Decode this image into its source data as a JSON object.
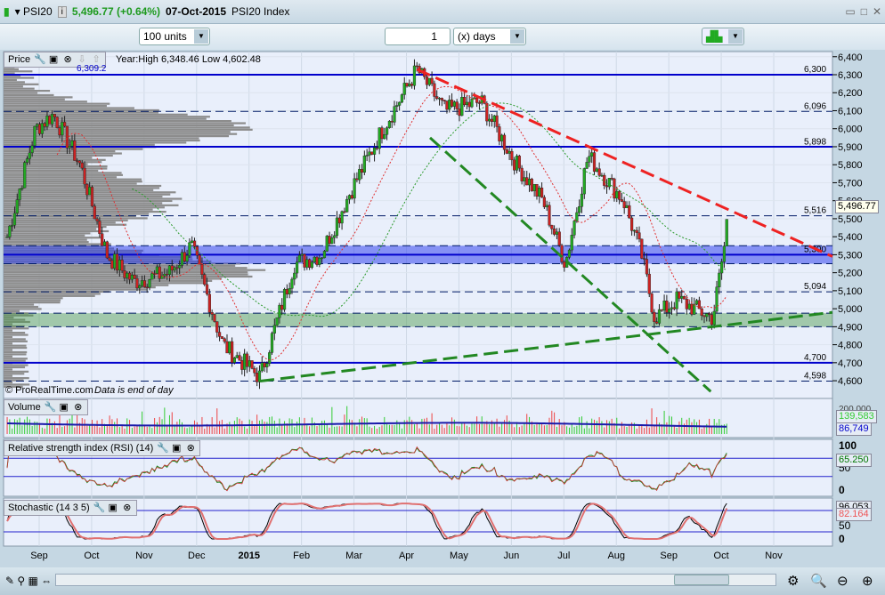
{
  "header": {
    "symbol": "PSI20",
    "price_change": "5,496.77 (+0.64%)",
    "date": "07-Oct-2015",
    "name": "PSI20 Index",
    "info_icon": "info-icon",
    "chart_type_icon": "candlestick-icon"
  },
  "toolbar": {
    "units": "100 units",
    "period_value": "1",
    "period_unit": "(x) days"
  },
  "price_panel": {
    "label": "Price",
    "year_info": "Year:High 6,348.46 Low 4,602.48",
    "top_level": "6,309.2",
    "copyright": "© ProRealTime.com",
    "eod_note": "Data is end of day",
    "current_tag": "5,496.77"
  },
  "volume_panel": {
    "label": "Volume",
    "value_tag": "139,583",
    "avg_tag": "86,749",
    "top_tick": "200,000"
  },
  "rsi_panel": {
    "label": "Relative strength index (RSI) (14)",
    "value_tag": "65.250",
    "ticks": [
      "100",
      "50",
      "0"
    ]
  },
  "stoch_panel": {
    "label": "Stochastic (14 3 5)",
    "k_tag": "96.053",
    "d_tag": "82.164",
    "ticks": [
      "50",
      "0"
    ]
  },
  "colors": {
    "bull": "#22aa22",
    "bear": "#cc2222",
    "level": "#0000cc",
    "red_trend": "#ee2222",
    "green_trend": "#228822"
  },
  "chart_data": {
    "type": "candlestick",
    "x_unit": "months since 1-Aug-2014",
    "y_axis": {
      "min": 4550,
      "max": 6450,
      "ticks": [
        4600,
        4700,
        4800,
        4900,
        5000,
        5100,
        5200,
        5300,
        5400,
        5500,
        5600,
        5700,
        5800,
        5900,
        6000,
        6100,
        6200,
        6300,
        6400
      ],
      "tick_labels": [
        "4,600",
        "4,700",
        "4,800",
        "4,900",
        "5,000",
        "5,100",
        "5,200",
        "5,300",
        "5,400",
        "5,500",
        "5,600",
        "5,700",
        "5,800",
        "5,900",
        "6,000",
        "6,100",
        "6,200",
        "6,300",
        "6,400"
      ]
    },
    "x_axis": {
      "labels": [
        "Sep",
        "Oct",
        "Nov",
        "Dec",
        "2015",
        "Feb",
        "Mar",
        "Apr",
        "May",
        "Jun",
        "Jul",
        "Aug",
        "Sep",
        "Oct",
        "Nov"
      ],
      "positions": [
        1,
        2,
        3,
        4,
        5,
        6,
        7,
        8,
        9,
        10,
        11,
        12,
        13,
        14,
        15
      ]
    },
    "close_keypoints": [
      [
        0.39,
        5400
      ],
      [
        0.93,
        6000
      ],
      [
        1.27,
        6080
      ],
      [
        1.78,
        5800
      ],
      [
        2.29,
        5300
      ],
      [
        2.8,
        5150
      ],
      [
        3.48,
        5200
      ],
      [
        3.9,
        5350
      ],
      [
        4.5,
        4800
      ],
      [
        5.21,
        4620
      ],
      [
        5.86,
        5250
      ],
      [
        6.37,
        5300
      ],
      [
        6.93,
        5650
      ],
      [
        7.55,
        6000
      ],
      [
        8.2,
        6330
      ],
      [
        8.74,
        6100
      ],
      [
        9.42,
        6150
      ],
      [
        10.1,
        5800
      ],
      [
        10.6,
        5600
      ],
      [
        11.03,
        5250
      ],
      [
        11.46,
        5850
      ],
      [
        12.14,
        5600
      ],
      [
        12.48,
        5300
      ],
      [
        12.73,
        4950
      ],
      [
        13.16,
        5050
      ],
      [
        13.84,
        4950
      ],
      [
        14.14,
        5497
      ]
    ],
    "solid_levels": [
      6300,
      5900,
      5300,
      4700
    ],
    "dashed_levels": [
      {
        "value": 6096,
        "label": "6,096"
      },
      {
        "value": 5516,
        "label": "5,516"
      },
      {
        "value": 5350,
        "label": ""
      },
      {
        "value": 5250,
        "label": ""
      },
      {
        "value": 5094,
        "label": "5,094"
      },
      {
        "value": 4975,
        "label": ""
      },
      {
        "value": 4900,
        "label": ""
      },
      {
        "value": 4598,
        "label": "4,598"
      }
    ],
    "level_labels": [
      {
        "value": 6300,
        "label": "6,300"
      },
      {
        "value": 5898,
        "label": "5,898"
      },
      {
        "value": 5300,
        "label": "5,300"
      },
      {
        "value": 4700,
        "label": "4,700"
      }
    ],
    "zones": [
      {
        "from": 5250,
        "to": 5350,
        "color": "blue"
      },
      {
        "from": 4900,
        "to": 4975,
        "color": "green"
      }
    ],
    "trendlines": [
      {
        "color": "red",
        "from": [
          8.2,
          6330
        ],
        "to": [
          16.2,
          5290
        ]
      },
      {
        "color": "green",
        "from": [
          5.21,
          4598
        ],
        "to": [
          16.2,
          4980
        ]
      },
      {
        "color": "green",
        "from": [
          8.45,
          5950
        ],
        "to": [
          13.8,
          4540
        ]
      }
    ]
  }
}
